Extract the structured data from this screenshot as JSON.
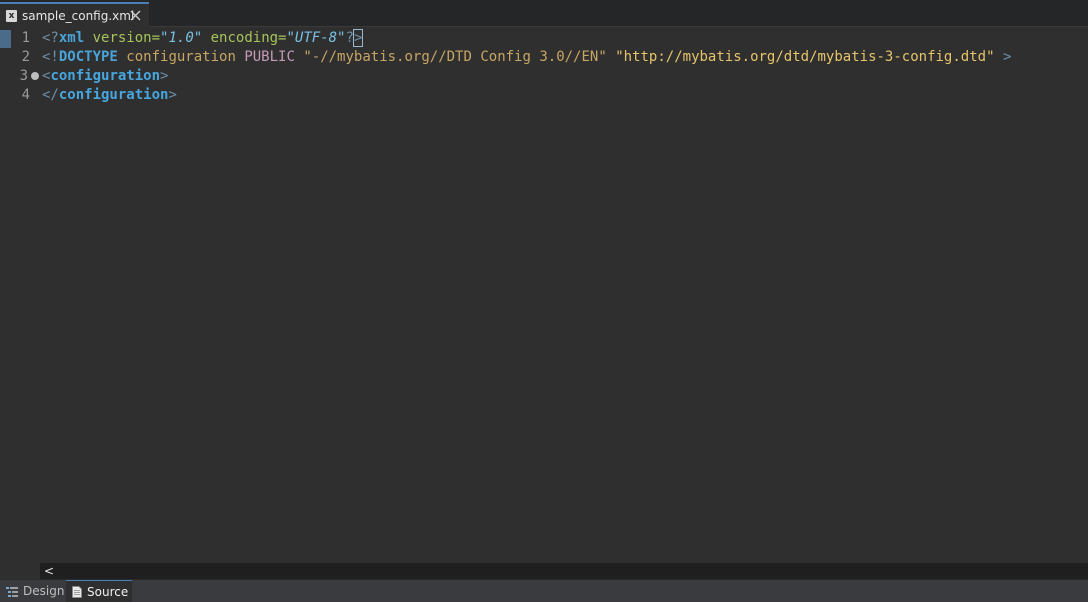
{
  "tab": {
    "filename": "sample_config.xml",
    "icon": "xml-file-icon",
    "icon_glyph": "x"
  },
  "editor": {
    "line_numbers": [
      "1",
      "2",
      "3",
      "4"
    ],
    "lines": {
      "l1": {
        "open": "<?",
        "xml": "xml",
        "attr1": " version",
        "eq1": "=",
        "val1": "\"1.0\"",
        "attr2": " encoding",
        "eq2": "=",
        "val2": "\"UTF-8\"",
        "close1": "?",
        "close2": ">"
      },
      "l2": {
        "open": "<!",
        "doctype": "DOCTYPE",
        "name": " configuration",
        "public": " PUBLIC",
        "pubid": " \"-//mybatis.org//DTD Config 3.0//EN\"",
        "sysid": " \"http://mybatis.org/dtd/mybatis-3-config.dtd\"",
        "close": " >"
      },
      "l3": {
        "open": "<",
        "tag": "configuration",
        "close": ">"
      },
      "l4": {
        "open": "</",
        "tag": "configuration",
        "close": ">"
      }
    }
  },
  "scrollbar": {
    "left_arrow": "<"
  },
  "bottom_tabs": {
    "design": "Design",
    "source": "Source",
    "active": "Source"
  }
}
